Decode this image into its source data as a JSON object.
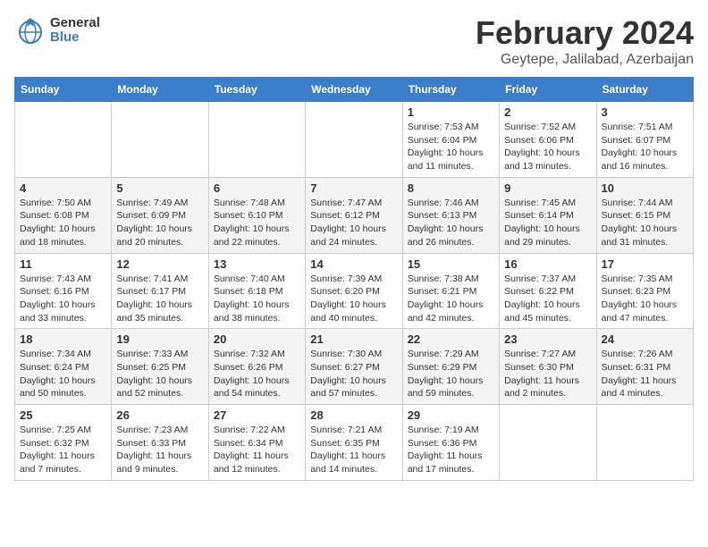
{
  "header": {
    "logo_general": "General",
    "logo_blue": "Blue",
    "title": "February 2024",
    "location": "Geytepe, Jalilabad, Azerbaijan"
  },
  "calendar": {
    "columns": [
      "Sunday",
      "Monday",
      "Tuesday",
      "Wednesday",
      "Thursday",
      "Friday",
      "Saturday"
    ],
    "rows": [
      [
        {
          "day": "",
          "info": ""
        },
        {
          "day": "",
          "info": ""
        },
        {
          "day": "",
          "info": ""
        },
        {
          "day": "",
          "info": ""
        },
        {
          "day": "1",
          "info": "Sunrise: 7:53 AM\nSunset: 6:04 PM\nDaylight: 10 hours\nand 11 minutes."
        },
        {
          "day": "2",
          "info": "Sunrise: 7:52 AM\nSunset: 6:06 PM\nDaylight: 10 hours\nand 13 minutes."
        },
        {
          "day": "3",
          "info": "Sunrise: 7:51 AM\nSunset: 6:07 PM\nDaylight: 10 hours\nand 16 minutes."
        }
      ],
      [
        {
          "day": "4",
          "info": "Sunrise: 7:50 AM\nSunset: 6:08 PM\nDaylight: 10 hours\nand 18 minutes."
        },
        {
          "day": "5",
          "info": "Sunrise: 7:49 AM\nSunset: 6:09 PM\nDaylight: 10 hours\nand 20 minutes."
        },
        {
          "day": "6",
          "info": "Sunrise: 7:48 AM\nSunset: 6:10 PM\nDaylight: 10 hours\nand 22 minutes."
        },
        {
          "day": "7",
          "info": "Sunrise: 7:47 AM\nSunset: 6:12 PM\nDaylight: 10 hours\nand 24 minutes."
        },
        {
          "day": "8",
          "info": "Sunrise: 7:46 AM\nSunset: 6:13 PM\nDaylight: 10 hours\nand 26 minutes."
        },
        {
          "day": "9",
          "info": "Sunrise: 7:45 AM\nSunset: 6:14 PM\nDaylight: 10 hours\nand 29 minutes."
        },
        {
          "day": "10",
          "info": "Sunrise: 7:44 AM\nSunset: 6:15 PM\nDaylight: 10 hours\nand 31 minutes."
        }
      ],
      [
        {
          "day": "11",
          "info": "Sunrise: 7:43 AM\nSunset: 6:16 PM\nDaylight: 10 hours\nand 33 minutes."
        },
        {
          "day": "12",
          "info": "Sunrise: 7:41 AM\nSunset: 6:17 PM\nDaylight: 10 hours\nand 35 minutes."
        },
        {
          "day": "13",
          "info": "Sunrise: 7:40 AM\nSunset: 6:18 PM\nDaylight: 10 hours\nand 38 minutes."
        },
        {
          "day": "14",
          "info": "Sunrise: 7:39 AM\nSunset: 6:20 PM\nDaylight: 10 hours\nand 40 minutes."
        },
        {
          "day": "15",
          "info": "Sunrise: 7:38 AM\nSunset: 6:21 PM\nDaylight: 10 hours\nand 42 minutes."
        },
        {
          "day": "16",
          "info": "Sunrise: 7:37 AM\nSunset: 6:22 PM\nDaylight: 10 hours\nand 45 minutes."
        },
        {
          "day": "17",
          "info": "Sunrise: 7:35 AM\nSunset: 6:23 PM\nDaylight: 10 hours\nand 47 minutes."
        }
      ],
      [
        {
          "day": "18",
          "info": "Sunrise: 7:34 AM\nSunset: 6:24 PM\nDaylight: 10 hours\nand 50 minutes."
        },
        {
          "day": "19",
          "info": "Sunrise: 7:33 AM\nSunset: 6:25 PM\nDaylight: 10 hours\nand 52 minutes."
        },
        {
          "day": "20",
          "info": "Sunrise: 7:32 AM\nSunset: 6:26 PM\nDaylight: 10 hours\nand 54 minutes."
        },
        {
          "day": "21",
          "info": "Sunrise: 7:30 AM\nSunset: 6:27 PM\nDaylight: 10 hours\nand 57 minutes."
        },
        {
          "day": "22",
          "info": "Sunrise: 7:29 AM\nSunset: 6:29 PM\nDaylight: 10 hours\nand 59 minutes."
        },
        {
          "day": "23",
          "info": "Sunrise: 7:27 AM\nSunset: 6:30 PM\nDaylight: 11 hours\nand 2 minutes."
        },
        {
          "day": "24",
          "info": "Sunrise: 7:26 AM\nSunset: 6:31 PM\nDaylight: 11 hours\nand 4 minutes."
        }
      ],
      [
        {
          "day": "25",
          "info": "Sunrise: 7:25 AM\nSunset: 6:32 PM\nDaylight: 11 hours\nand 7 minutes."
        },
        {
          "day": "26",
          "info": "Sunrise: 7:23 AM\nSunset: 6:33 PM\nDaylight: 11 hours\nand 9 minutes."
        },
        {
          "day": "27",
          "info": "Sunrise: 7:22 AM\nSunset: 6:34 PM\nDaylight: 11 hours\nand 12 minutes."
        },
        {
          "day": "28",
          "info": "Sunrise: 7:21 AM\nSunset: 6:35 PM\nDaylight: 11 hours\nand 14 minutes."
        },
        {
          "day": "29",
          "info": "Sunrise: 7:19 AM\nSunset: 6:36 PM\nDaylight: 11 hours\nand 17 minutes."
        },
        {
          "day": "",
          "info": ""
        },
        {
          "day": "",
          "info": ""
        }
      ]
    ]
  }
}
